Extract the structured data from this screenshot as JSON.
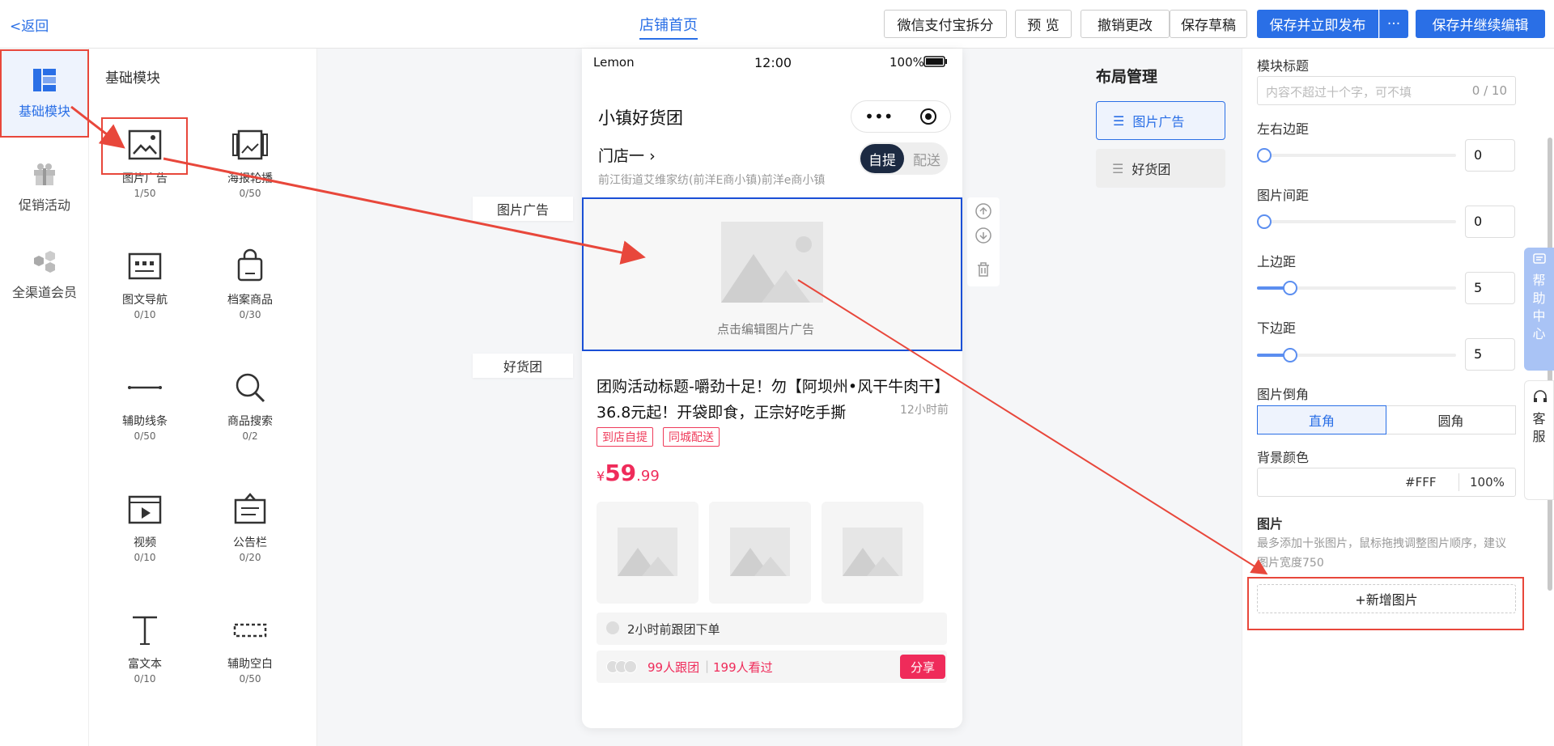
{
  "topbar": {
    "back": "<返回",
    "title": "店铺首页",
    "btn_wechat": "微信支付宝拆分",
    "btn_preview": "预 览",
    "btn_undo": "撤销更改",
    "btn_draft": "保存草稿",
    "btn_publish": "保存并立即发布",
    "btn_more": "···",
    "btn_continue": "保存并继续编辑"
  },
  "leftnav": {
    "items": [
      "基础模块",
      "促销活动",
      "全渠道会员"
    ]
  },
  "modpanel": {
    "title": "基础模块",
    "modules": [
      {
        "label": "图片广告",
        "count": "1/50"
      },
      {
        "label": "海报轮播",
        "count": "0/50"
      },
      {
        "label": "图文导航",
        "count": "0/10"
      },
      {
        "label": "档案商品",
        "count": "0/30"
      },
      {
        "label": "辅助线条",
        "count": "0/50"
      },
      {
        "label": "商品搜索",
        "count": "0/2"
      },
      {
        "label": "视频",
        "count": "0/10"
      },
      {
        "label": "公告栏",
        "count": "0/20"
      },
      {
        "label": "富文本",
        "count": "0/10"
      },
      {
        "label": "辅助空白",
        "count": "0/50"
      }
    ]
  },
  "phone": {
    "status_carrier": "Lemon",
    "status_time": "12:00",
    "status_battery": "100%",
    "shop_title": "小镇好货团",
    "store": "门店一",
    "address": "前江街道艾维家纺(前洋E商小镇)前洋e商小镇",
    "seg_on": "自提",
    "seg_off": "配送",
    "ad_placeholder": "点击编辑图片广告",
    "goods_title": "团购活动标题-嚼劲十足！勿【阿坝州•风干牛肉干】36.8元起！开袋即食，正宗好吃手撕",
    "goods_time": "12小时前",
    "tags": [
      "到店自提",
      "同城配送"
    ],
    "price_symbol": "¥",
    "price_int": "59",
    "price_dec": ".99",
    "recent_order": "2小时前跟团下单",
    "followers": "99人跟团",
    "viewers": "199人看过",
    "share": "分享"
  },
  "side_tags": {
    "ad": "图片广告",
    "group": "好货团"
  },
  "layout": {
    "title": "布局管理",
    "items": [
      "图片广告",
      "好货团"
    ]
  },
  "props": {
    "module_title_label": "模块标题",
    "module_title_placeholder": "内容不超过十个字，可不填",
    "module_title_count": "0 / 10",
    "lr_margin_label": "左右边距",
    "lr_margin_value": "0",
    "img_gap_label": "图片间距",
    "img_gap_value": "0",
    "top_margin_label": "上边距",
    "top_margin_value": "5",
    "bottom_margin_label": "下边距",
    "bottom_margin_value": "5",
    "corner_label": "图片倒角",
    "corner_square": "直角",
    "corner_round": "圆角",
    "bg_label": "背景颜色",
    "bg_value": "#FFF",
    "bg_opacity": "100%",
    "images_label": "图片",
    "images_hint": "最多添加十张图片，鼠标拖拽调整图片顺序，建议图片宽度750",
    "add_image": "+新增图片"
  },
  "help": {
    "text": "帮助中心",
    "kefu": "客服"
  },
  "colors": {
    "primary": "#2a6fe6",
    "accent": "#ef2b5a",
    "annotation": "#e8473b"
  }
}
